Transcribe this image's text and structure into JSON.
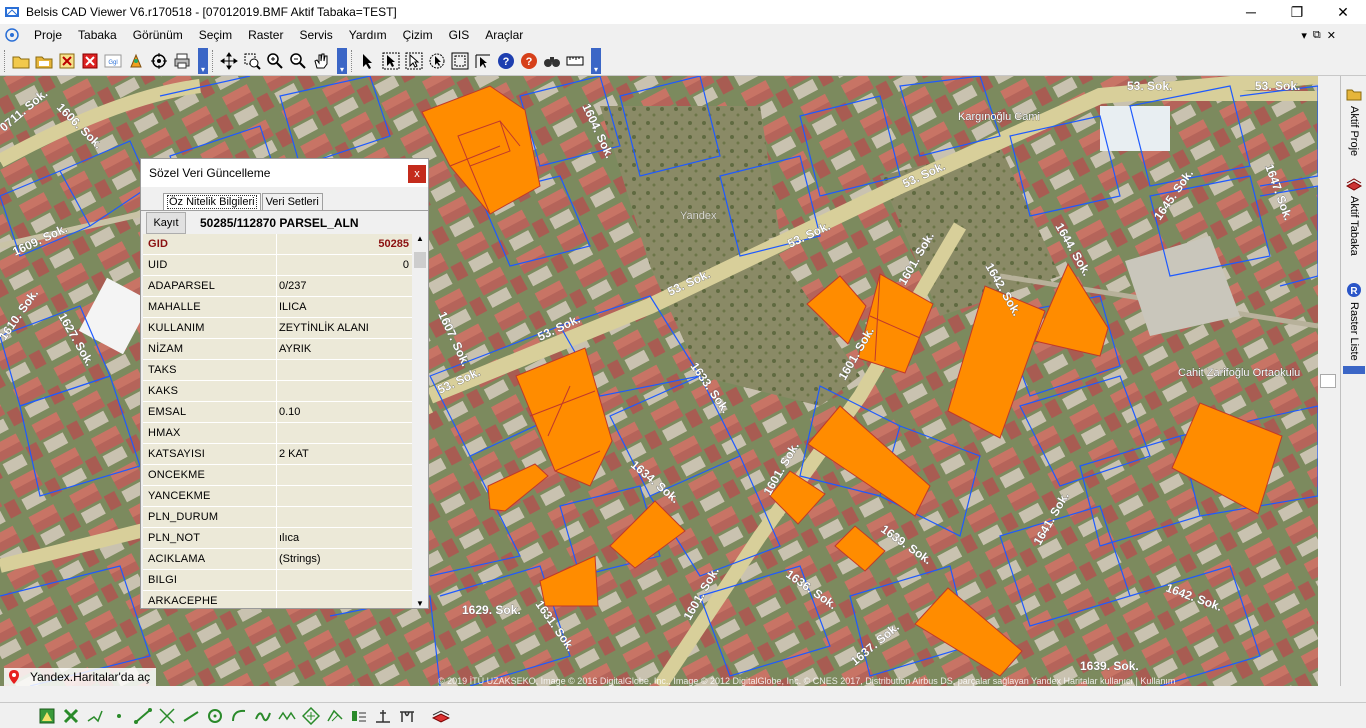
{
  "window": {
    "title": "Belsis CAD Viewer V6.r170518 - [07012019.BMF  Aktif Tabaka=TEST]",
    "minimize": "─",
    "maximize": "❐",
    "close": "✕"
  },
  "menu": {
    "items": [
      "Proje",
      "Tabaka",
      "Görünüm",
      "Seçim",
      "Raster",
      "Servis",
      "Yardım",
      "Çizim",
      "GIS",
      "Araçlar"
    ],
    "mdi": [
      "▾",
      "⧉",
      "✕"
    ]
  },
  "map": {
    "streets": [
      "53. Sok.",
      "53. Sok.",
      "53. Sok.",
      "53. Sok.",
      "53. Sok.",
      "53. Sok.",
      "53. Sok.",
      "1601. Sok.",
      "1601. Sok.",
      "1601. Sok.",
      "1601. Sok.",
      "1633. Sok.",
      "1634. Sok.",
      "1636. Sok.",
      "1637. Sok.",
      "1639. Sok.",
      "1641. Sok.",
      "1642. Sok.",
      "1642. Sok.",
      "1644. Sok.",
      "1645. Sok.",
      "1647. Sok.",
      "1609. Sok.",
      "1610. Sok.",
      "1627. Sok.",
      "1607. Sok.",
      "1604. Sok.",
      "1606. Sok.",
      "0711. Sok.",
      "1629. Sok.",
      "1631. Sok.",
      "1639. Sok."
    ],
    "places": [
      "Kargınoğlu Cami",
      "Cahit Zarifoğlu Ortaokulu",
      "Yandex"
    ],
    "yandex_link": "Yandex.Haritalar'da aç",
    "copyright": "© 2019 İTÜ UZAKSEKO, Image © 2016 DigitalGlobe, Inc., Image © 2012 DigitalGlobe, Inc. © CNES 2017, Distribution Airbus DS, parçalar sağlayan Yandex Haritalar kullanıcı | Kullanım"
  },
  "right_panel": {
    "tabs": [
      "Aktif Proje",
      "Aktif Tabaka",
      "Raster Liste"
    ]
  },
  "dialog": {
    "title": "Sözel Veri Güncelleme",
    "close": "x",
    "tabs": [
      "Öz Nitelik Bilgileri",
      "Veri Setleri"
    ],
    "save_label": "Kayıt",
    "parcel": "50285/112870 PARSEL_ALN",
    "rows": [
      {
        "key": "GID",
        "value": "50285"
      },
      {
        "key": "UID",
        "value": "0"
      },
      {
        "key": "ADAPARSEL",
        "value": "0/237"
      },
      {
        "key": "MAHALLE",
        "value": "ILICA"
      },
      {
        "key": "KULLANIM",
        "value": "ZEYTİNLİK ALANI"
      },
      {
        "key": "NİZAM",
        "value": "AYRIK"
      },
      {
        "key": "TAKS",
        "value": ""
      },
      {
        "key": "KAKS",
        "value": ""
      },
      {
        "key": "EMSAL",
        "value": "0.10"
      },
      {
        "key": "HMAX",
        "value": ""
      },
      {
        "key": "KATSAYISI",
        "value": "2 KAT"
      },
      {
        "key": "ONCEKME",
        "value": ""
      },
      {
        "key": "YANCEKME",
        "value": ""
      },
      {
        "key": "PLN_DURUM",
        "value": ""
      },
      {
        "key": "PLN_NOT",
        "value": "ılıca"
      },
      {
        "key": "ACIKLAMA",
        "value": "(Strings)"
      },
      {
        "key": "BILGI",
        "value": ""
      },
      {
        "key": "ARKACEPHE",
        "value": ""
      }
    ]
  },
  "colors": {
    "parcel_fill": "#ff8c00",
    "parcel_line": "#1e5aff",
    "road": "#d8cf9a",
    "gid_text": "#8b1010"
  }
}
